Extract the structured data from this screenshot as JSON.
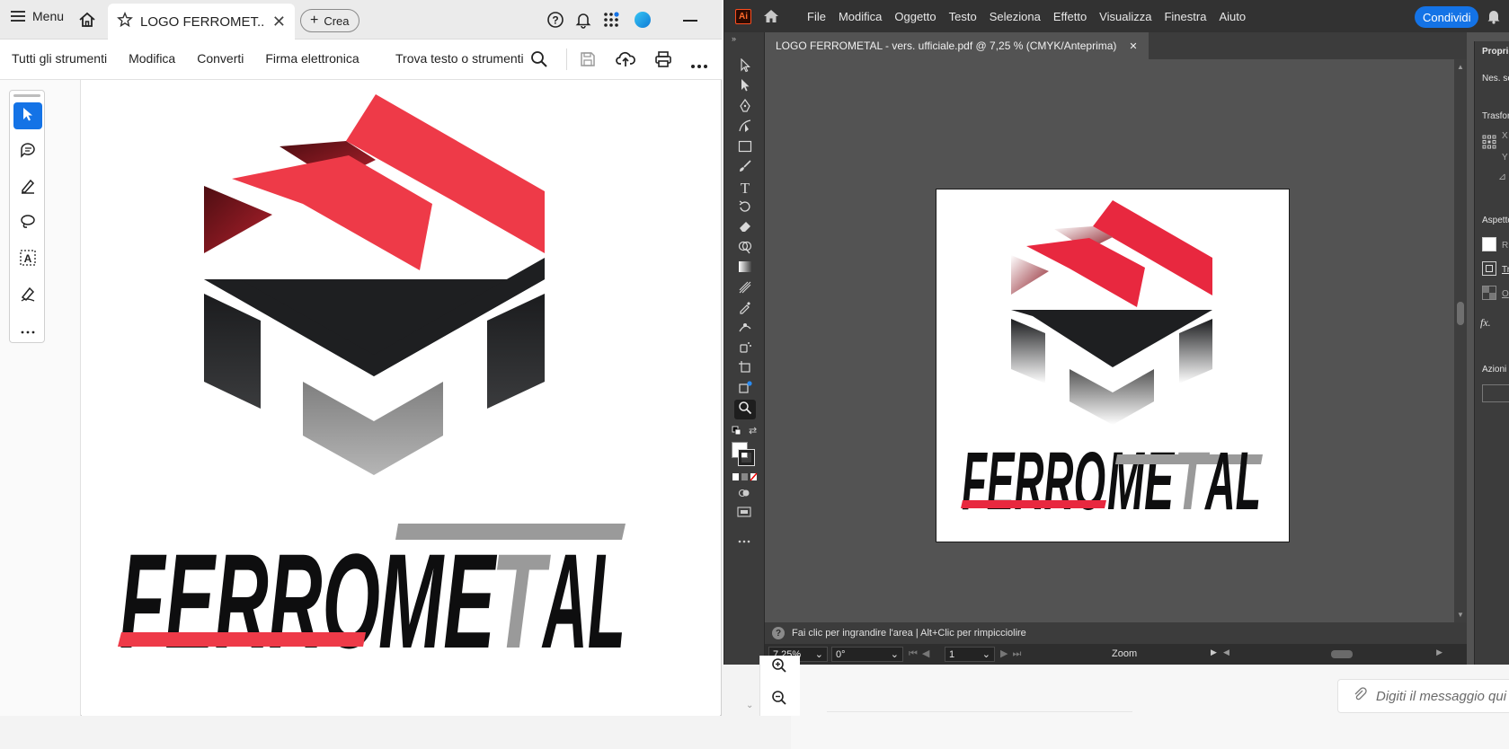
{
  "acrobat": {
    "menu_label": "Menu",
    "tab_title": "LOGO FERROMET...",
    "new_label": "Crea",
    "tools": [
      "Tutti gli strumenti",
      "Modifica",
      "Converti",
      "Firma elettronica"
    ],
    "search_label": "Trova testo o strumenti",
    "logo_text_left": "FERRO",
    "logo_text_right": "ME",
    "logo_text_t": "T",
    "logo_text_end": "AL"
  },
  "illustrator": {
    "logo": "Ai",
    "menus": [
      "File",
      "Modifica",
      "Oggetto",
      "Testo",
      "Seleziona",
      "Effetto",
      "Visualizza",
      "Finestra",
      "Aiuto"
    ],
    "share_label": "Condividi",
    "doc_tab": "LOGO FERROMETAL - vers. ufficiale.pdf @ 7,25 % (CMYK/Anteprima)",
    "status_text": "Fai clic per ingrandire l'area  |  Alt+Clic per rimpicciolire",
    "zoom_value": "7,25%",
    "rotation_value": "0°",
    "artboard_value": "1",
    "zoom_label": "Zoom",
    "panel": {
      "title": "Propriet",
      "no_selection": "Nes. sele",
      "transform": "Trasform",
      "x": "X",
      "y": "Y",
      "appearance": "Aspetto",
      "fill": "R",
      "stroke": "Tr",
      "opacity": "O",
      "fx": "fx.",
      "quick_actions": "Azioni ra"
    }
  },
  "background": {
    "chat_placeholder": "Digiti il messaggio qui"
  },
  "colors": {
    "brand_red": "#ee3a48",
    "brand_dark_red": "#8a1822",
    "brand_black": "#1e1f21",
    "brand_gray": "#9a9a9a",
    "adobe_blue": "#1473e6"
  }
}
